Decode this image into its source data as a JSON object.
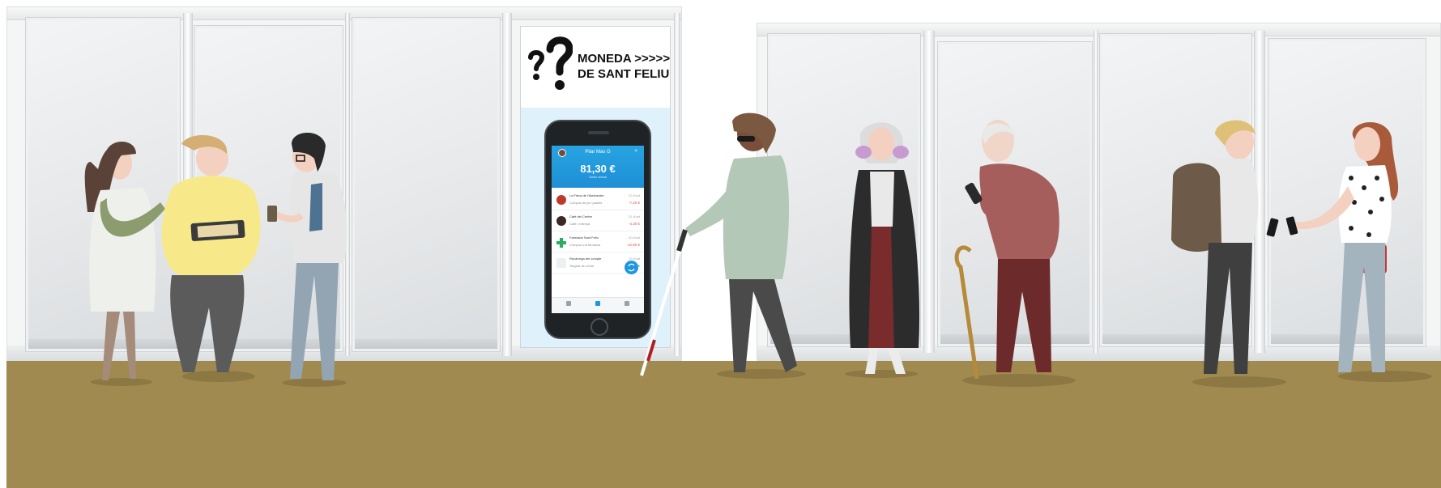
{
  "poster": {
    "title_line1": "MONEDA >>>>>",
    "title_line2": "DE SANT FELIU"
  },
  "app": {
    "user_name": "Pilar Mas G",
    "close_icon": "×",
    "balance": "81,30 €",
    "balance_caption": "Saldo actual",
    "transactions": [
      {
        "title": "La Fleca de l'Aleixandre",
        "subtitle": "Compra de pa i pastes",
        "date": "22 d'oct",
        "amount": "-7,20 €",
        "amount_color": "#d9534f",
        "icon_color": "#c0392b",
        "icon": "bakery-logo-icon"
      },
      {
        "title": "Cafè del Centre",
        "subtitle": "Cafè i entrepà",
        "date": "21 d'oct",
        "amount": "-4,30 €",
        "amount_color": "#d9534f",
        "icon_color": "#3b2a23",
        "icon": "cafe-logo-icon"
      },
      {
        "title": "Farmàcia Sant Feliu",
        "subtitle": "Compra a la farmàcia",
        "date": "20 d'oct",
        "amount": "-12,60 €",
        "amount_color": "#d9534f",
        "icon_color": "#27ae60",
        "icon": "pharmacy-cross-icon"
      },
      {
        "title": "Recàrrega del compte",
        "subtitle": "Targeta de crèdit",
        "date": "19 d'oct",
        "amount": "+ 50,00 €",
        "amount_color": "#27ae60",
        "icon_color": "#7f8c8d",
        "icon": "card-icon"
      }
    ],
    "tabs": [
      "store-icon",
      "user-icon",
      "settings-icon"
    ]
  },
  "colors": {
    "floor": "#a08a4f",
    "app_accent": "#1f96dd",
    "poster_panel": "#dff1fb"
  }
}
